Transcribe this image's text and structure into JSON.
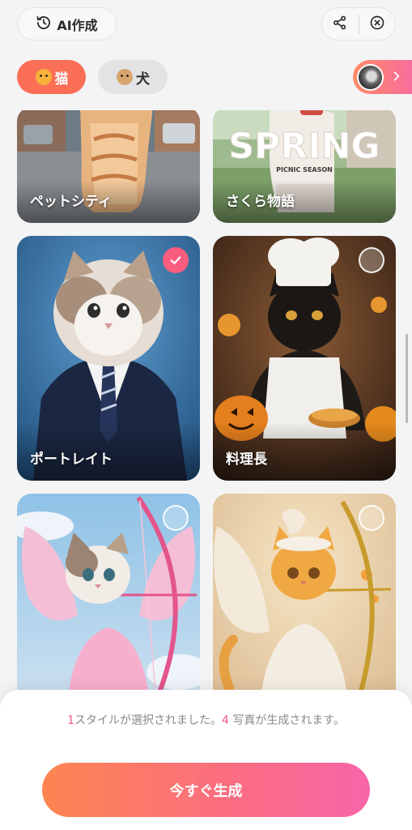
{
  "top_bar": {
    "history_label": "AI作成",
    "history_icon": "history-clock-icon",
    "share_icon": "share-icon",
    "close_icon": "close-circle-icon"
  },
  "categories": [
    {
      "label": "猫",
      "icon": "cat-face-icon",
      "selected": true
    },
    {
      "label": "犬",
      "icon": "dog-face-icon",
      "selected": false
    }
  ],
  "upload": {
    "icon": "chevron-right-icon"
  },
  "styles": [
    {
      "label": "ペットシティ",
      "selected": false
    },
    {
      "label": "さくら物語",
      "selected": false,
      "artwork_text": "SPRING",
      "artwork_subtext": "PICNIC SEASON"
    },
    {
      "label": "ポートレイト",
      "selected": true
    },
    {
      "label": "料理長",
      "selected": false
    },
    {
      "label": "",
      "selected": false
    },
    {
      "label": "",
      "selected": false
    }
  ],
  "sheet": {
    "style_count": "1",
    "message_part1": "スタイルが選択されました。",
    "photo_count": "4",
    "message_part2": " 写真が生成されます。",
    "generate_label": "今すぐ生成"
  },
  "colors": {
    "accent_start": "#fd8550",
    "accent_end": "#f765a9",
    "selected_chip": "#fb6f57",
    "check": "#fb5d7e"
  }
}
